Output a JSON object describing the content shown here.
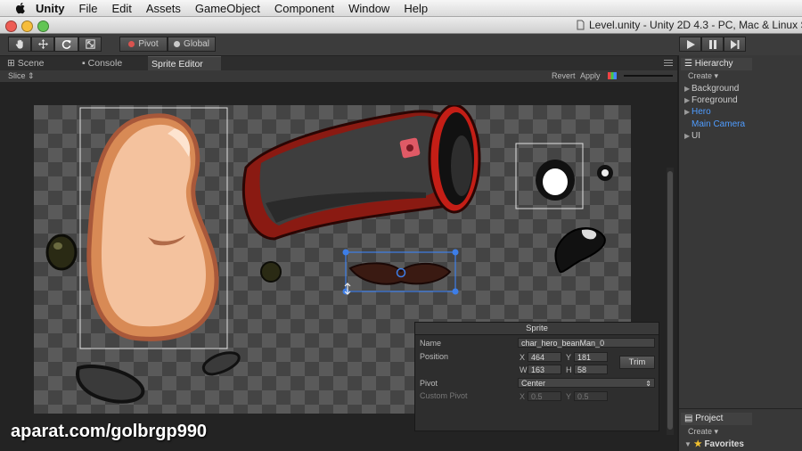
{
  "menubar": {
    "app": "Unity",
    "items": [
      "File",
      "Edit",
      "Assets",
      "GameObject",
      "Component",
      "Window",
      "Help"
    ]
  },
  "window": {
    "title": "Level.unity - Unity 2D 4.3 - PC, Mac & Linux S"
  },
  "toolbar": {
    "tools": [
      "hand-icon",
      "move-icon",
      "rotate-icon",
      "scale-icon"
    ],
    "active_tool": "rotate-icon",
    "pivot_label": "Pivot",
    "global_label": "Global"
  },
  "tabs": [
    "Scene",
    "Console",
    "Sprite Editor"
  ],
  "sprite_editor_toolbar": {
    "slice_label": "Slice ⇕",
    "revert_label": "Revert",
    "apply_label": "Apply"
  },
  "sprite_panel": {
    "title": "Sprite",
    "name_label": "Name",
    "name_value": "char_hero_beanMan_0",
    "position_label": "Position",
    "x_label": "X",
    "x_value": "464",
    "y_label": "Y",
    "y_value": "181",
    "w_label": "W",
    "w_value": "163",
    "h_label": "H",
    "h_value": "58",
    "trim_label": "Trim",
    "pivot_label": "Pivot",
    "pivot_value": "Center",
    "custom_pivot_label": "Custom Pivot",
    "custom_x_label": "X",
    "custom_x_value": "0.5",
    "custom_y_label": "Y",
    "custom_y_value": "0.5"
  },
  "hierarchy": {
    "tab_label": "Hierarchy",
    "create_label": "Create ▾",
    "items": [
      {
        "label": "Background",
        "expandable": true
      },
      {
        "label": "Foreground",
        "expandable": true
      },
      {
        "label": "Hero",
        "expandable": true
      },
      {
        "label": "Main Camera",
        "expandable": false
      },
      {
        "label": "UI",
        "expandable": true
      }
    ]
  },
  "project": {
    "tab_label": "Project",
    "create_label": "Create ▾",
    "favorites_label": "Favorites"
  },
  "watermark": "aparat.com/golbrgp990",
  "colors": {
    "selection_handle": "#3d7ee8",
    "blue_item": "#4f9cff"
  }
}
